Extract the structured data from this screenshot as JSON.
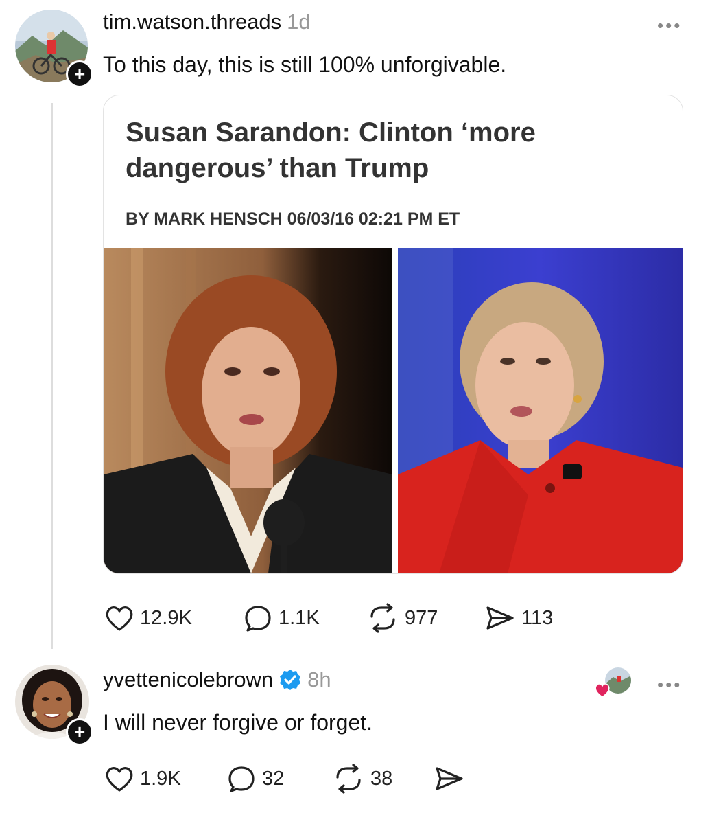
{
  "post": {
    "username": "tim.watson.threads",
    "time": "1d",
    "text": "To this day, this is still 100% unforgivable.",
    "card": {
      "headline": "Susan Sarandon: Clinton ‘more dangerous’ than Trump",
      "byline": "BY MARK HENSCH 06/03/16 02:21 PM ET"
    },
    "stats": {
      "likes": "12.9K",
      "replies": "1.1K",
      "reposts": "977",
      "shares": "113"
    }
  },
  "reply": {
    "username": "yvettenicolebrown",
    "verified": true,
    "time": "8h",
    "text": "I will never forgive or forget.",
    "stats": {
      "likes": "1.9K",
      "replies": "32",
      "reposts": "38"
    }
  },
  "colors": {
    "verified_blue": "#1D9BF0",
    "like_red": "#E0245E",
    "muted_gray": "#999999"
  },
  "icons": [
    "plus-icon",
    "more-icon",
    "heart-icon",
    "reply-icon",
    "repost-icon",
    "share-icon",
    "verified-icon"
  ]
}
